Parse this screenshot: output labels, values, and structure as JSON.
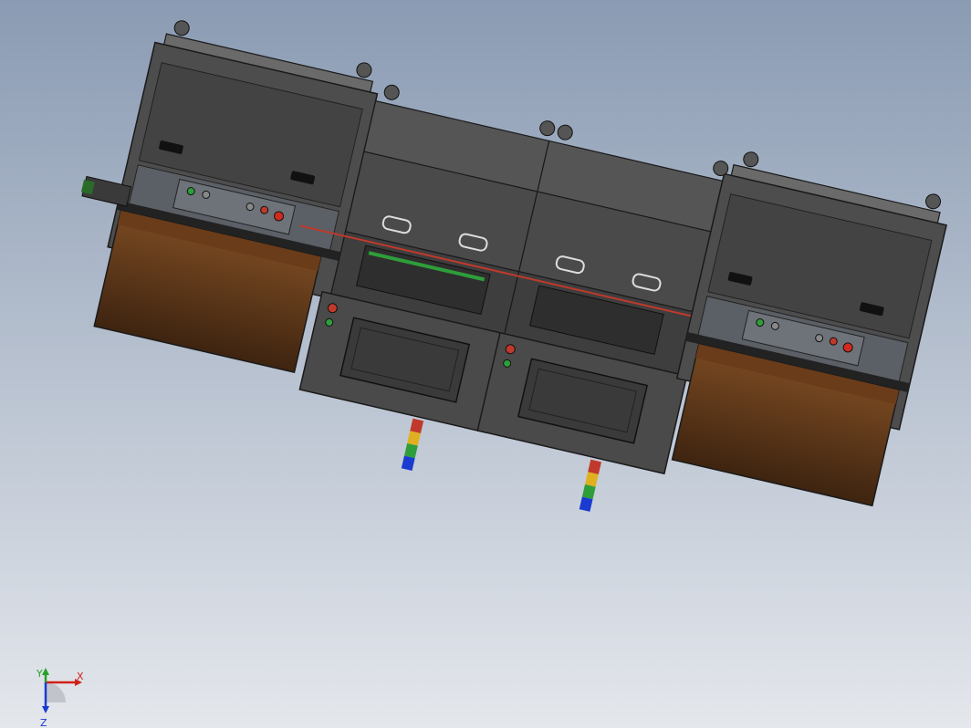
{
  "scene": {
    "background_top": "#8a9bb3",
    "background_bottom": "#e4e7ec",
    "body_color": "#4a4a4a",
    "panel_color": "#3a3a3a",
    "outline_color": "#1a1a1a",
    "bin_color": "#5a3418",
    "accent_red": "#c0392b",
    "accent_green": "#2e9e3a"
  },
  "triad": {
    "x_label": "X",
    "y_label": "Y",
    "z_label": "Z",
    "x_color": "#d0201a",
    "y_color": "#2aa02a",
    "z_color": "#1a3ad0"
  }
}
